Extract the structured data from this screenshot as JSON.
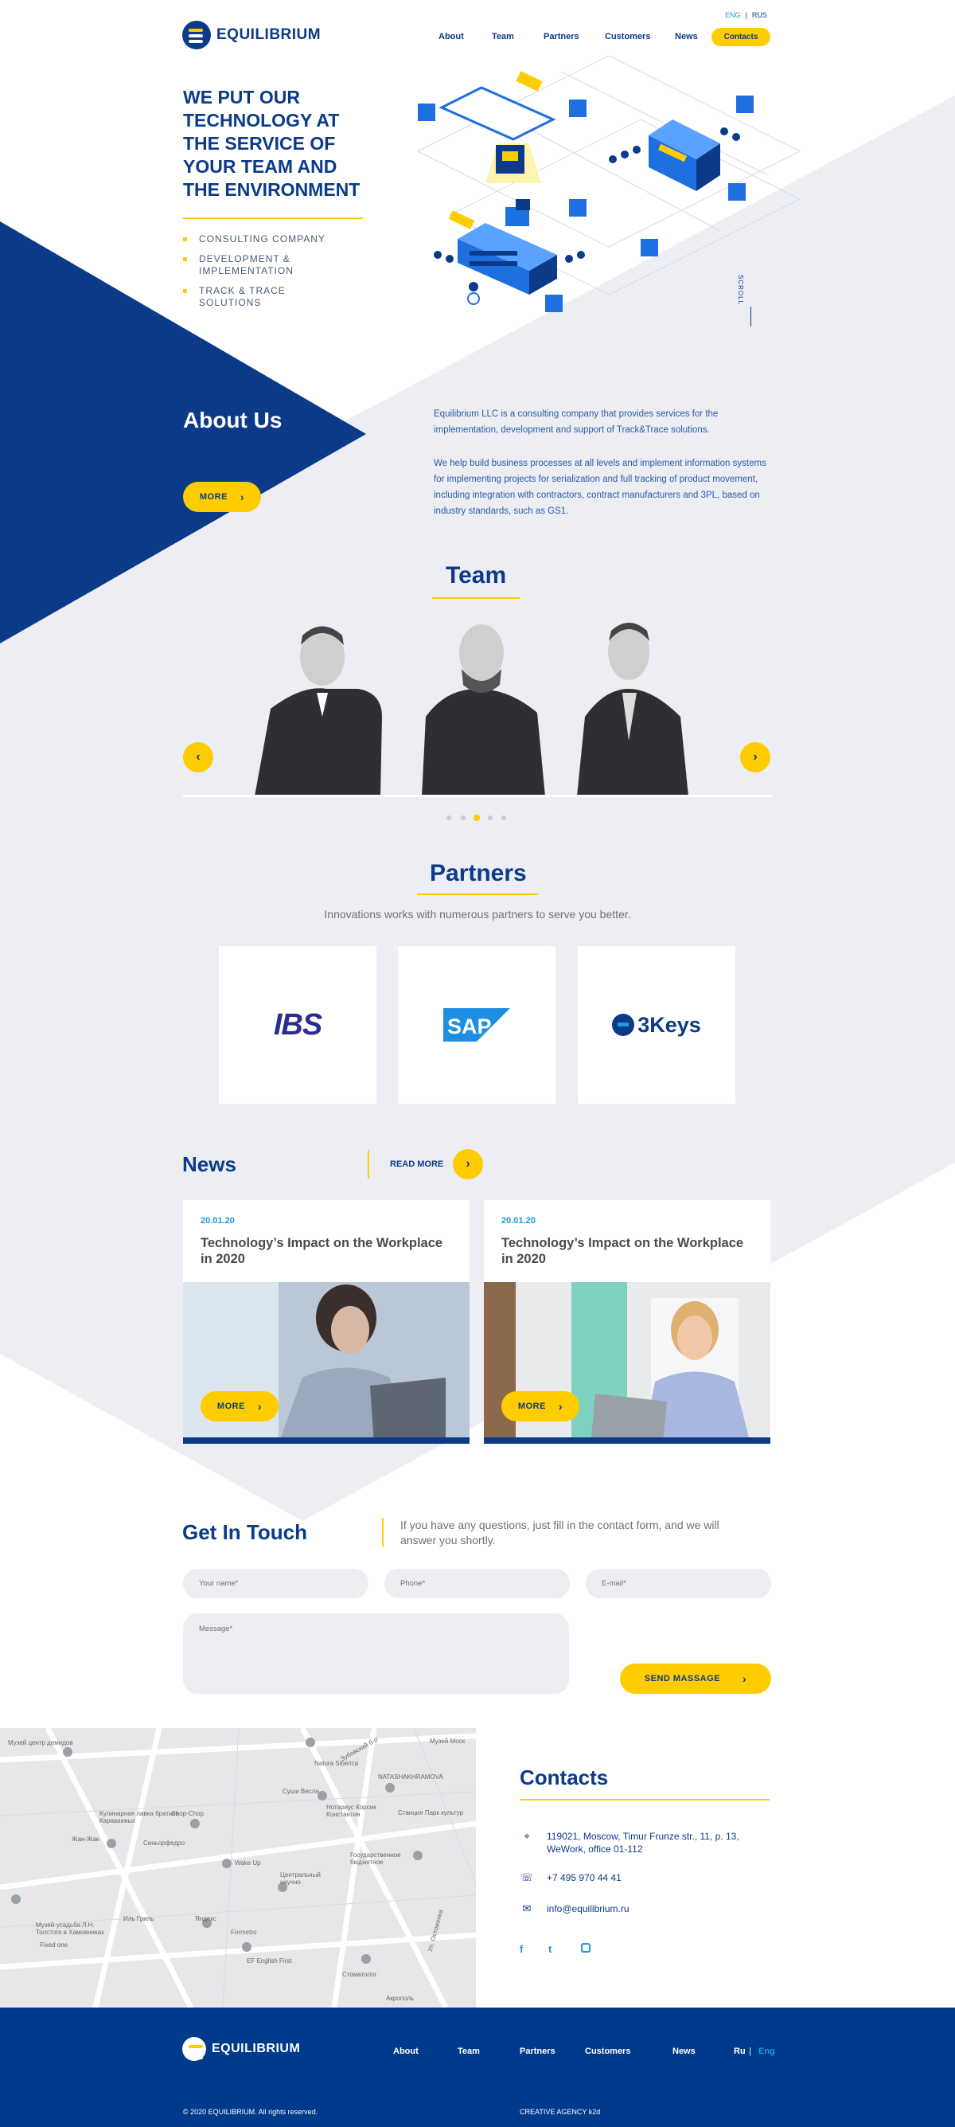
{
  "header": {
    "lang": {
      "eng": "ENG",
      "sep": "|",
      "rus": "RUS"
    },
    "brand": "EQUILIBRIUM",
    "nav": [
      "About",
      "Team",
      "Partners",
      "Customers",
      "News"
    ],
    "contacts_button": "Contacts"
  },
  "hero": {
    "title": "WE PUT OUR TECHNOLOGY AT THE SERVICE OF YOUR TEAM AND THE ENVIRONMENT",
    "items": [
      "CONSULTING COMPANY",
      "DEVELOPMENT & IMPLEMENTATION",
      "TRACK & TRACE SOLUTIONS"
    ],
    "scroll": "SCROLL"
  },
  "about": {
    "title": "About Us",
    "more": "MORE",
    "p1": "Equilibrium LLC is a consulting company that provides services for the implementation, development and support of Track&Trace solutions.",
    "p2": "We help build business processes at all levels and implement information systems for implementing projects for serialization and full tracking of product movement, including integration with contractors, contract manufacturers and 3PL, based on industry standards, such as GS1."
  },
  "team": {
    "title": "Team",
    "members": 3,
    "pages": 5,
    "active_page": 3
  },
  "partners": {
    "title": "Partners",
    "subtitle": "Innovations works with numerous partners to serve you better.",
    "logos": [
      "IBS",
      "SAP",
      "3Keys"
    ]
  },
  "news": {
    "title": "News",
    "read_more": "READ MORE",
    "items": [
      {
        "date": "20.01.20",
        "title": "Technology’s Impact on the Workplace in 2020",
        "more": "MORE"
      },
      {
        "date": "20.01.20",
        "title": "Technology’s Impact on the Workplace in 2020",
        "more": "MORE"
      }
    ]
  },
  "touch": {
    "title": "Get In Touch",
    "text": "If you have any questions, just fill in the contact form, and we will answer you shortly.",
    "name_placeholder": "Your name*",
    "phone_placeholder": "Phone*",
    "email_placeholder": "E-mail*",
    "message_placeholder": "Message*",
    "send": "SEND MASSAGE"
  },
  "map": {
    "labels": [
      "Музей центр демидов",
      "Зубовский б-р",
      "Музей Моск",
      "Natura Siberica",
      "NATASHAKHRAMOVA",
      "Кулинарная лавка братьев Караваевых",
      "Chop-Chop",
      "Нотариус Корсик Константин",
      "Станция Парк культур",
      "Суши Весла",
      "Жан-Жак",
      "Сеньорфедро",
      "Wake Up",
      "Государственное бюджетное",
      "Центральный научно",
      "Яндекс",
      "Музей-усадьба Л.Н. Толстого в Хамовниках",
      "Fixed one",
      "Иль Гриль",
      "Formetro",
      "EF English First",
      "Стоматолог",
      "Акрополь",
      "Ул. Остоженка"
    ]
  },
  "contacts": {
    "title": "Contacts",
    "address": "119021, Moscow, Timur Frunze str., 11, p. 13, WeWork, office 01-112",
    "phone": "+7 495 970 44 41",
    "email": "info@equilibrium.ru",
    "social": [
      "f",
      "t",
      "o"
    ]
  },
  "footer": {
    "brand": "EQUILIBRIUM",
    "nav": [
      "About",
      "Team",
      "Partners",
      "Customers",
      "News"
    ],
    "lang": {
      "ru": "Ru",
      "sep": "|",
      "eng": "Eng"
    },
    "copyright": "© 2020 EQUILIBRIUM. All rights reserved.",
    "agency": "CREATIVE AGENCY k2d"
  },
  "colors": {
    "navy": "#0b3a88",
    "yellow": "#ffcc00",
    "gray_bg": "#eceef3",
    "footer": "#003a8c",
    "accent_blue": "#1e9ad6"
  }
}
